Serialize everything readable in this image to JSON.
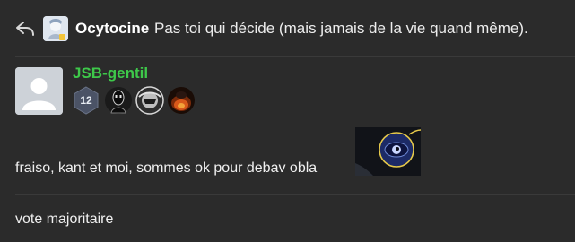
{
  "reply": {
    "icon": "reply-arrow-icon",
    "author": "Ocytocine",
    "text": "Pas toi qui décide (mais jamais de la vie quand même)."
  },
  "post": {
    "username": "JSB-gentil",
    "username_color": "#3ec84a",
    "avatar": "default-avatar",
    "badges": [
      {
        "type": "level",
        "value": "12"
      },
      {
        "type": "emoji",
        "icon": "masked-figure-icon"
      },
      {
        "type": "emoji",
        "icon": "helmet-icon"
      },
      {
        "type": "emoji",
        "icon": "fire-orb-icon"
      }
    ]
  },
  "messages": [
    {
      "text": "fraiso, kant et moi, sommes ok pour debav obla",
      "sticker": "planet-eye-sticker"
    },
    {
      "text": "vote majoritaire"
    }
  ],
  "colors": {
    "background": "#2b2b2b",
    "text": "#f0f0f0",
    "separator": "#3a3a3a"
  }
}
